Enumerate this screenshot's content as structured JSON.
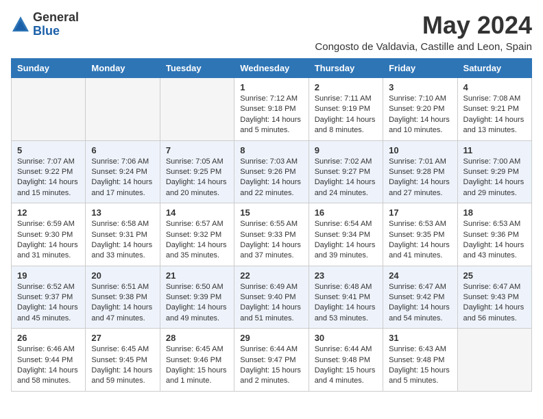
{
  "logo": {
    "general": "General",
    "blue": "Blue"
  },
  "title": "May 2024",
  "location": "Congosto de Valdavia, Castille and Leon, Spain",
  "days_header": [
    "Sunday",
    "Monday",
    "Tuesday",
    "Wednesday",
    "Thursday",
    "Friday",
    "Saturday"
  ],
  "weeks": [
    [
      {
        "day": "",
        "info": ""
      },
      {
        "day": "",
        "info": ""
      },
      {
        "day": "",
        "info": ""
      },
      {
        "day": "1",
        "info": "Sunrise: 7:12 AM\nSunset: 9:18 PM\nDaylight: 14 hours\nand 5 minutes."
      },
      {
        "day": "2",
        "info": "Sunrise: 7:11 AM\nSunset: 9:19 PM\nDaylight: 14 hours\nand 8 minutes."
      },
      {
        "day": "3",
        "info": "Sunrise: 7:10 AM\nSunset: 9:20 PM\nDaylight: 14 hours\nand 10 minutes."
      },
      {
        "day": "4",
        "info": "Sunrise: 7:08 AM\nSunset: 9:21 PM\nDaylight: 14 hours\nand 13 minutes."
      }
    ],
    [
      {
        "day": "5",
        "info": "Sunrise: 7:07 AM\nSunset: 9:22 PM\nDaylight: 14 hours\nand 15 minutes."
      },
      {
        "day": "6",
        "info": "Sunrise: 7:06 AM\nSunset: 9:24 PM\nDaylight: 14 hours\nand 17 minutes."
      },
      {
        "day": "7",
        "info": "Sunrise: 7:05 AM\nSunset: 9:25 PM\nDaylight: 14 hours\nand 20 minutes."
      },
      {
        "day": "8",
        "info": "Sunrise: 7:03 AM\nSunset: 9:26 PM\nDaylight: 14 hours\nand 22 minutes."
      },
      {
        "day": "9",
        "info": "Sunrise: 7:02 AM\nSunset: 9:27 PM\nDaylight: 14 hours\nand 24 minutes."
      },
      {
        "day": "10",
        "info": "Sunrise: 7:01 AM\nSunset: 9:28 PM\nDaylight: 14 hours\nand 27 minutes."
      },
      {
        "day": "11",
        "info": "Sunrise: 7:00 AM\nSunset: 9:29 PM\nDaylight: 14 hours\nand 29 minutes."
      }
    ],
    [
      {
        "day": "12",
        "info": "Sunrise: 6:59 AM\nSunset: 9:30 PM\nDaylight: 14 hours\nand 31 minutes."
      },
      {
        "day": "13",
        "info": "Sunrise: 6:58 AM\nSunset: 9:31 PM\nDaylight: 14 hours\nand 33 minutes."
      },
      {
        "day": "14",
        "info": "Sunrise: 6:57 AM\nSunset: 9:32 PM\nDaylight: 14 hours\nand 35 minutes."
      },
      {
        "day": "15",
        "info": "Sunrise: 6:55 AM\nSunset: 9:33 PM\nDaylight: 14 hours\nand 37 minutes."
      },
      {
        "day": "16",
        "info": "Sunrise: 6:54 AM\nSunset: 9:34 PM\nDaylight: 14 hours\nand 39 minutes."
      },
      {
        "day": "17",
        "info": "Sunrise: 6:53 AM\nSunset: 9:35 PM\nDaylight: 14 hours\nand 41 minutes."
      },
      {
        "day": "18",
        "info": "Sunrise: 6:53 AM\nSunset: 9:36 PM\nDaylight: 14 hours\nand 43 minutes."
      }
    ],
    [
      {
        "day": "19",
        "info": "Sunrise: 6:52 AM\nSunset: 9:37 PM\nDaylight: 14 hours\nand 45 minutes."
      },
      {
        "day": "20",
        "info": "Sunrise: 6:51 AM\nSunset: 9:38 PM\nDaylight: 14 hours\nand 47 minutes."
      },
      {
        "day": "21",
        "info": "Sunrise: 6:50 AM\nSunset: 9:39 PM\nDaylight: 14 hours\nand 49 minutes."
      },
      {
        "day": "22",
        "info": "Sunrise: 6:49 AM\nSunset: 9:40 PM\nDaylight: 14 hours\nand 51 minutes."
      },
      {
        "day": "23",
        "info": "Sunrise: 6:48 AM\nSunset: 9:41 PM\nDaylight: 14 hours\nand 53 minutes."
      },
      {
        "day": "24",
        "info": "Sunrise: 6:47 AM\nSunset: 9:42 PM\nDaylight: 14 hours\nand 54 minutes."
      },
      {
        "day": "25",
        "info": "Sunrise: 6:47 AM\nSunset: 9:43 PM\nDaylight: 14 hours\nand 56 minutes."
      }
    ],
    [
      {
        "day": "26",
        "info": "Sunrise: 6:46 AM\nSunset: 9:44 PM\nDaylight: 14 hours\nand 58 minutes."
      },
      {
        "day": "27",
        "info": "Sunrise: 6:45 AM\nSunset: 9:45 PM\nDaylight: 14 hours\nand 59 minutes."
      },
      {
        "day": "28",
        "info": "Sunrise: 6:45 AM\nSunset: 9:46 PM\nDaylight: 15 hours\nand 1 minute."
      },
      {
        "day": "29",
        "info": "Sunrise: 6:44 AM\nSunset: 9:47 PM\nDaylight: 15 hours\nand 2 minutes."
      },
      {
        "day": "30",
        "info": "Sunrise: 6:44 AM\nSunset: 9:48 PM\nDaylight: 15 hours\nand 4 minutes."
      },
      {
        "day": "31",
        "info": "Sunrise: 6:43 AM\nSunset: 9:48 PM\nDaylight: 15 hours\nand 5 minutes."
      },
      {
        "day": "",
        "info": ""
      }
    ]
  ]
}
